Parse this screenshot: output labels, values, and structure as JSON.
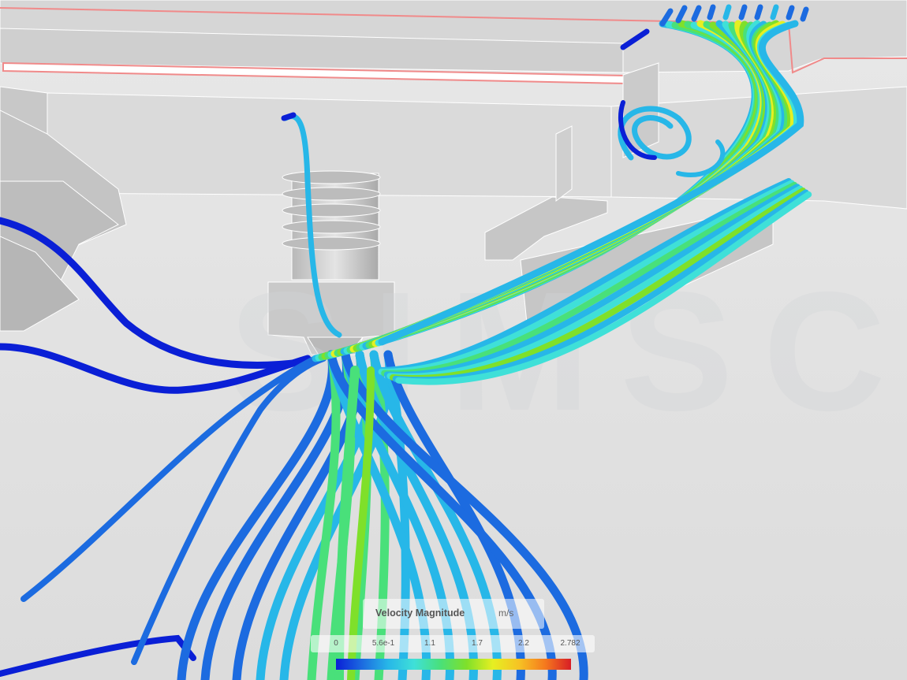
{
  "watermark": "SIMSCALE",
  "legend": {
    "title": "Velocity Magnitude",
    "unit": "m/s",
    "ticks": [
      "0",
      "5.6e-1",
      "1.1",
      "1.7",
      "2.2",
      "2.782"
    ],
    "range": [
      0,
      2.782
    ],
    "colormap": [
      "#0a1fd6",
      "#1c6be0",
      "#27b7e8",
      "#3fe0d8",
      "#49e07a",
      "#7fe02a",
      "#e6ef22",
      "#f6c324",
      "#f57a1e",
      "#d81d25"
    ]
  },
  "colors": {
    "background": "#e6e6e6",
    "geometry_outline": "#ffffff",
    "highlight_edge": "#f08a8a"
  }
}
